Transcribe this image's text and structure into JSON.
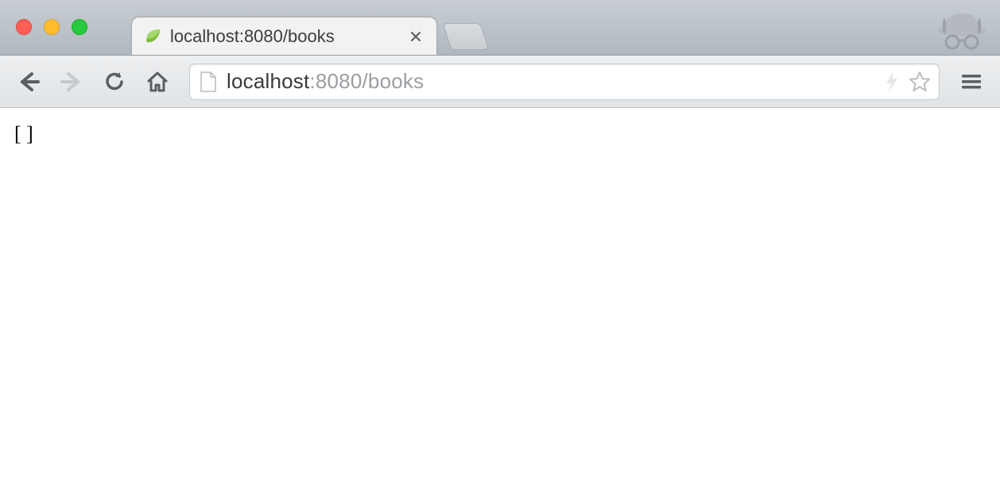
{
  "window": {
    "traffic_lights": [
      "close",
      "minimize",
      "zoom"
    ]
  },
  "tabs": [
    {
      "title": "localhost:8080/books",
      "favicon": "spring-leaf-icon",
      "active": true
    }
  ],
  "incognito": true,
  "toolbar": {
    "back_enabled": true,
    "forward_enabled": false,
    "reload_label": "Reload",
    "home_label": "Home"
  },
  "omnibox": {
    "page_icon": "file-icon",
    "url_host": "localhost",
    "url_port_path": ":8080/books",
    "bookmark_icon": "star-icon",
    "action_icon": "bolt-icon"
  },
  "menu_icon": "hamburger-icon",
  "page": {
    "body_text": "[ ]"
  }
}
